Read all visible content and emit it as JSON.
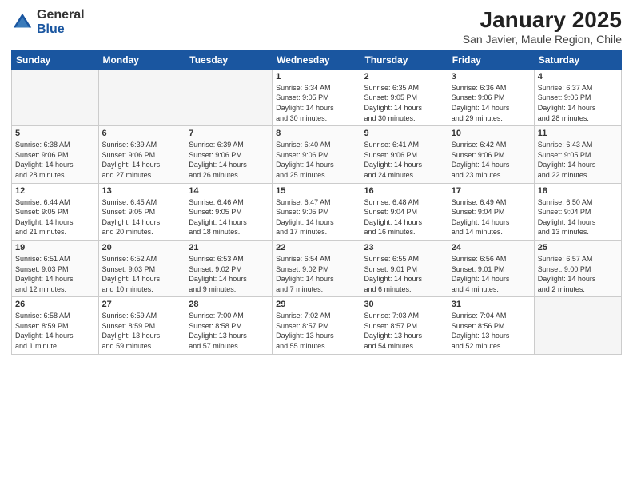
{
  "logo": {
    "general": "General",
    "blue": "Blue"
  },
  "header": {
    "title": "January 2025",
    "subtitle": "San Javier, Maule Region, Chile"
  },
  "days_of_week": [
    "Sunday",
    "Monday",
    "Tuesday",
    "Wednesday",
    "Thursday",
    "Friday",
    "Saturday"
  ],
  "weeks": [
    [
      {
        "day": "",
        "info": ""
      },
      {
        "day": "",
        "info": ""
      },
      {
        "day": "",
        "info": ""
      },
      {
        "day": "1",
        "info": "Sunrise: 6:34 AM\nSunset: 9:05 PM\nDaylight: 14 hours\nand 30 minutes."
      },
      {
        "day": "2",
        "info": "Sunrise: 6:35 AM\nSunset: 9:05 PM\nDaylight: 14 hours\nand 30 minutes."
      },
      {
        "day": "3",
        "info": "Sunrise: 6:36 AM\nSunset: 9:06 PM\nDaylight: 14 hours\nand 29 minutes."
      },
      {
        "day": "4",
        "info": "Sunrise: 6:37 AM\nSunset: 9:06 PM\nDaylight: 14 hours\nand 28 minutes."
      }
    ],
    [
      {
        "day": "5",
        "info": "Sunrise: 6:38 AM\nSunset: 9:06 PM\nDaylight: 14 hours\nand 28 minutes."
      },
      {
        "day": "6",
        "info": "Sunrise: 6:39 AM\nSunset: 9:06 PM\nDaylight: 14 hours\nand 27 minutes."
      },
      {
        "day": "7",
        "info": "Sunrise: 6:39 AM\nSunset: 9:06 PM\nDaylight: 14 hours\nand 26 minutes."
      },
      {
        "day": "8",
        "info": "Sunrise: 6:40 AM\nSunset: 9:06 PM\nDaylight: 14 hours\nand 25 minutes."
      },
      {
        "day": "9",
        "info": "Sunrise: 6:41 AM\nSunset: 9:06 PM\nDaylight: 14 hours\nand 24 minutes."
      },
      {
        "day": "10",
        "info": "Sunrise: 6:42 AM\nSunset: 9:06 PM\nDaylight: 14 hours\nand 23 minutes."
      },
      {
        "day": "11",
        "info": "Sunrise: 6:43 AM\nSunset: 9:05 PM\nDaylight: 14 hours\nand 22 minutes."
      }
    ],
    [
      {
        "day": "12",
        "info": "Sunrise: 6:44 AM\nSunset: 9:05 PM\nDaylight: 14 hours\nand 21 minutes."
      },
      {
        "day": "13",
        "info": "Sunrise: 6:45 AM\nSunset: 9:05 PM\nDaylight: 14 hours\nand 20 minutes."
      },
      {
        "day": "14",
        "info": "Sunrise: 6:46 AM\nSunset: 9:05 PM\nDaylight: 14 hours\nand 18 minutes."
      },
      {
        "day": "15",
        "info": "Sunrise: 6:47 AM\nSunset: 9:05 PM\nDaylight: 14 hours\nand 17 minutes."
      },
      {
        "day": "16",
        "info": "Sunrise: 6:48 AM\nSunset: 9:04 PM\nDaylight: 14 hours\nand 16 minutes."
      },
      {
        "day": "17",
        "info": "Sunrise: 6:49 AM\nSunset: 9:04 PM\nDaylight: 14 hours\nand 14 minutes."
      },
      {
        "day": "18",
        "info": "Sunrise: 6:50 AM\nSunset: 9:04 PM\nDaylight: 14 hours\nand 13 minutes."
      }
    ],
    [
      {
        "day": "19",
        "info": "Sunrise: 6:51 AM\nSunset: 9:03 PM\nDaylight: 14 hours\nand 12 minutes."
      },
      {
        "day": "20",
        "info": "Sunrise: 6:52 AM\nSunset: 9:03 PM\nDaylight: 14 hours\nand 10 minutes."
      },
      {
        "day": "21",
        "info": "Sunrise: 6:53 AM\nSunset: 9:02 PM\nDaylight: 14 hours\nand 9 minutes."
      },
      {
        "day": "22",
        "info": "Sunrise: 6:54 AM\nSunset: 9:02 PM\nDaylight: 14 hours\nand 7 minutes."
      },
      {
        "day": "23",
        "info": "Sunrise: 6:55 AM\nSunset: 9:01 PM\nDaylight: 14 hours\nand 6 minutes."
      },
      {
        "day": "24",
        "info": "Sunrise: 6:56 AM\nSunset: 9:01 PM\nDaylight: 14 hours\nand 4 minutes."
      },
      {
        "day": "25",
        "info": "Sunrise: 6:57 AM\nSunset: 9:00 PM\nDaylight: 14 hours\nand 2 minutes."
      }
    ],
    [
      {
        "day": "26",
        "info": "Sunrise: 6:58 AM\nSunset: 8:59 PM\nDaylight: 14 hours\nand 1 minute."
      },
      {
        "day": "27",
        "info": "Sunrise: 6:59 AM\nSunset: 8:59 PM\nDaylight: 13 hours\nand 59 minutes."
      },
      {
        "day": "28",
        "info": "Sunrise: 7:00 AM\nSunset: 8:58 PM\nDaylight: 13 hours\nand 57 minutes."
      },
      {
        "day": "29",
        "info": "Sunrise: 7:02 AM\nSunset: 8:57 PM\nDaylight: 13 hours\nand 55 minutes."
      },
      {
        "day": "30",
        "info": "Sunrise: 7:03 AM\nSunset: 8:57 PM\nDaylight: 13 hours\nand 54 minutes."
      },
      {
        "day": "31",
        "info": "Sunrise: 7:04 AM\nSunset: 8:56 PM\nDaylight: 13 hours\nand 52 minutes."
      },
      {
        "day": "",
        "info": ""
      }
    ]
  ]
}
